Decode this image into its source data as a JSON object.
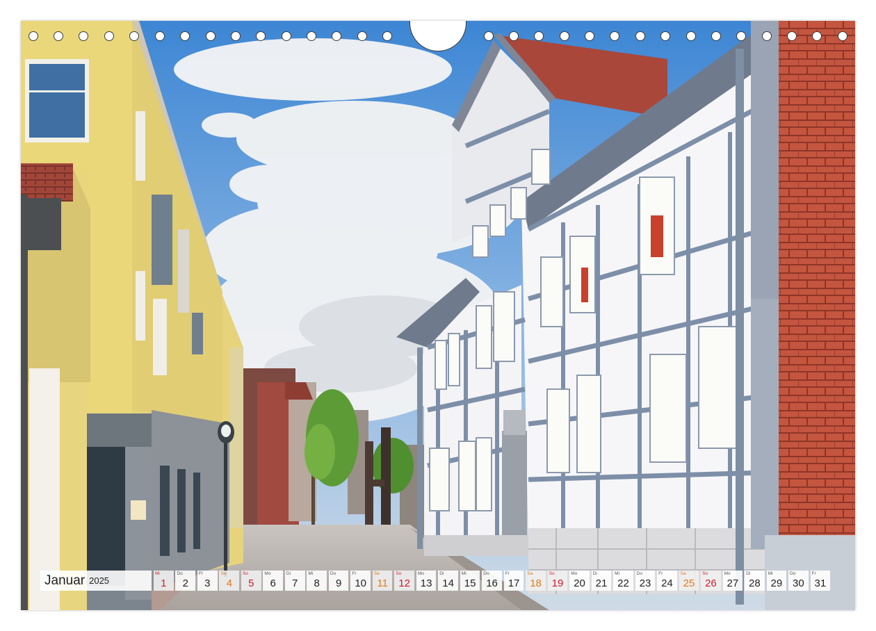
{
  "calendar": {
    "month": "Januar",
    "year": "2025",
    "days": [
      {
        "n": "1",
        "dn": "Mi",
        "t": "so"
      },
      {
        "n": "2",
        "dn": "Do",
        "t": ""
      },
      {
        "n": "3",
        "dn": "Fr",
        "t": ""
      },
      {
        "n": "4",
        "dn": "Sa",
        "t": "sa"
      },
      {
        "n": "5",
        "dn": "So",
        "t": "so"
      },
      {
        "n": "6",
        "dn": "Mo",
        "t": ""
      },
      {
        "n": "7",
        "dn": "Di",
        "t": ""
      },
      {
        "n": "8",
        "dn": "Mi",
        "t": ""
      },
      {
        "n": "9",
        "dn": "Do",
        "t": ""
      },
      {
        "n": "10",
        "dn": "Fr",
        "t": ""
      },
      {
        "n": "11",
        "dn": "Sa",
        "t": "sa"
      },
      {
        "n": "12",
        "dn": "So",
        "t": "so"
      },
      {
        "n": "13",
        "dn": "Mo",
        "t": ""
      },
      {
        "n": "14",
        "dn": "Di",
        "t": ""
      },
      {
        "n": "15",
        "dn": "Mi",
        "t": ""
      },
      {
        "n": "16",
        "dn": "Do",
        "t": ""
      },
      {
        "n": "17",
        "dn": "Fr",
        "t": ""
      },
      {
        "n": "18",
        "dn": "Sa",
        "t": "sa"
      },
      {
        "n": "19",
        "dn": "So",
        "t": "so"
      },
      {
        "n": "20",
        "dn": "Mo",
        "t": ""
      },
      {
        "n": "21",
        "dn": "Di",
        "t": ""
      },
      {
        "n": "22",
        "dn": "Mi",
        "t": ""
      },
      {
        "n": "23",
        "dn": "Do",
        "t": ""
      },
      {
        "n": "24",
        "dn": "Fr",
        "t": ""
      },
      {
        "n": "25",
        "dn": "Sa",
        "t": "sa"
      },
      {
        "n": "26",
        "dn": "So",
        "t": "so"
      },
      {
        "n": "27",
        "dn": "Mo",
        "t": ""
      },
      {
        "n": "28",
        "dn": "Di",
        "t": ""
      },
      {
        "n": "29",
        "dn": "Mi",
        "t": ""
      },
      {
        "n": "30",
        "dn": "Do",
        "t": ""
      },
      {
        "n": "31",
        "dn": "Fr",
        "t": ""
      }
    ]
  },
  "colors": {
    "saturday": "#e0781c",
    "sunday": "#d01c2a",
    "sky": "#4f93d8",
    "yellow_facade": "#ead77a",
    "timber_blue": "#7d8fa8",
    "roof_red": "#b4483a"
  }
}
